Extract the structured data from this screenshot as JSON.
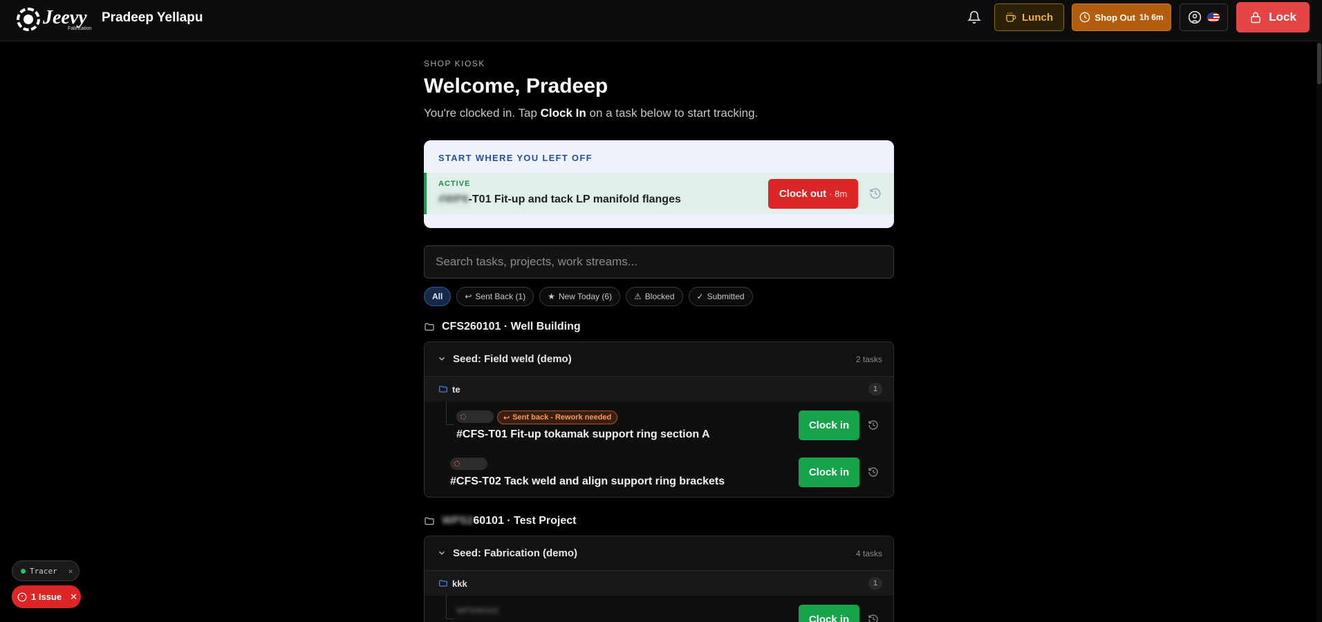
{
  "header": {
    "logo_text": "Jeevy",
    "logo_sub": "Fabrication",
    "user_name": "Pradeep Yellapu",
    "lunch_label": "Lunch",
    "shop_out_label": "Shop Out",
    "shop_out_duration": "1h 6m",
    "lock_label": "Lock"
  },
  "page": {
    "kicker": "SHOP KIOSK",
    "welcome": "Welcome, Pradeep",
    "subtext_before": "You're clocked in. Tap ",
    "subtext_bold": "Clock In",
    "subtext_after": " on a task below to start tracking."
  },
  "resume": {
    "title": "START WHERE YOU LEFT OFF",
    "status": "ACTIVE",
    "task_prefix_blurred": "#WP6",
    "task_title": "-T01 Fit-up and tack LP manifold flanges",
    "clock_out_label": "Clock out",
    "clock_out_duration": "· 8m"
  },
  "search": {
    "placeholder": "Search tasks, projects, work streams..."
  },
  "filters": [
    {
      "label": "All",
      "icon": ""
    },
    {
      "label": "Sent Back (1)",
      "icon": "↩"
    },
    {
      "label": "New Today (6)",
      "icon": "★"
    },
    {
      "label": "Blocked",
      "icon": "⚠"
    },
    {
      "label": "Submitted",
      "icon": "✓"
    }
  ],
  "projects": [
    {
      "name": "CFS260101 · Well Building",
      "group": {
        "title": "Seed: Field weld (demo)",
        "count": "2 tasks",
        "stream": {
          "name": "te",
          "count": "1"
        },
        "tasks": [
          {
            "badge": "Sent back - Rework needed",
            "title": "#CFS-T01 Fit-up tokamak support ring section A",
            "action": "Clock in"
          },
          {
            "badge": "",
            "title": "#CFS-T02 Tack weld and align support ring brackets",
            "action": "Clock in"
          }
        ]
      }
    },
    {
      "name_blurred": "WPS2",
      "name": "60101 · Test Project",
      "group": {
        "title": "Seed: Fabrication (demo)",
        "count": "4 tasks",
        "stream": {
          "name": "kkk",
          "count": "1"
        },
        "tasks": [
          {
            "badge_blurred": "WPS260101",
            "title": "",
            "action": "Clock in"
          }
        ]
      }
    }
  ],
  "devtools": {
    "tracer_label": "Tracer",
    "issue_label": "1 Issue"
  },
  "colors": {
    "lock": "#e64545",
    "clock_in": "#16a34a",
    "clock_out": "#dc2626",
    "shop_out": "#b35e0e",
    "lunch_text": "#f2b43a"
  }
}
